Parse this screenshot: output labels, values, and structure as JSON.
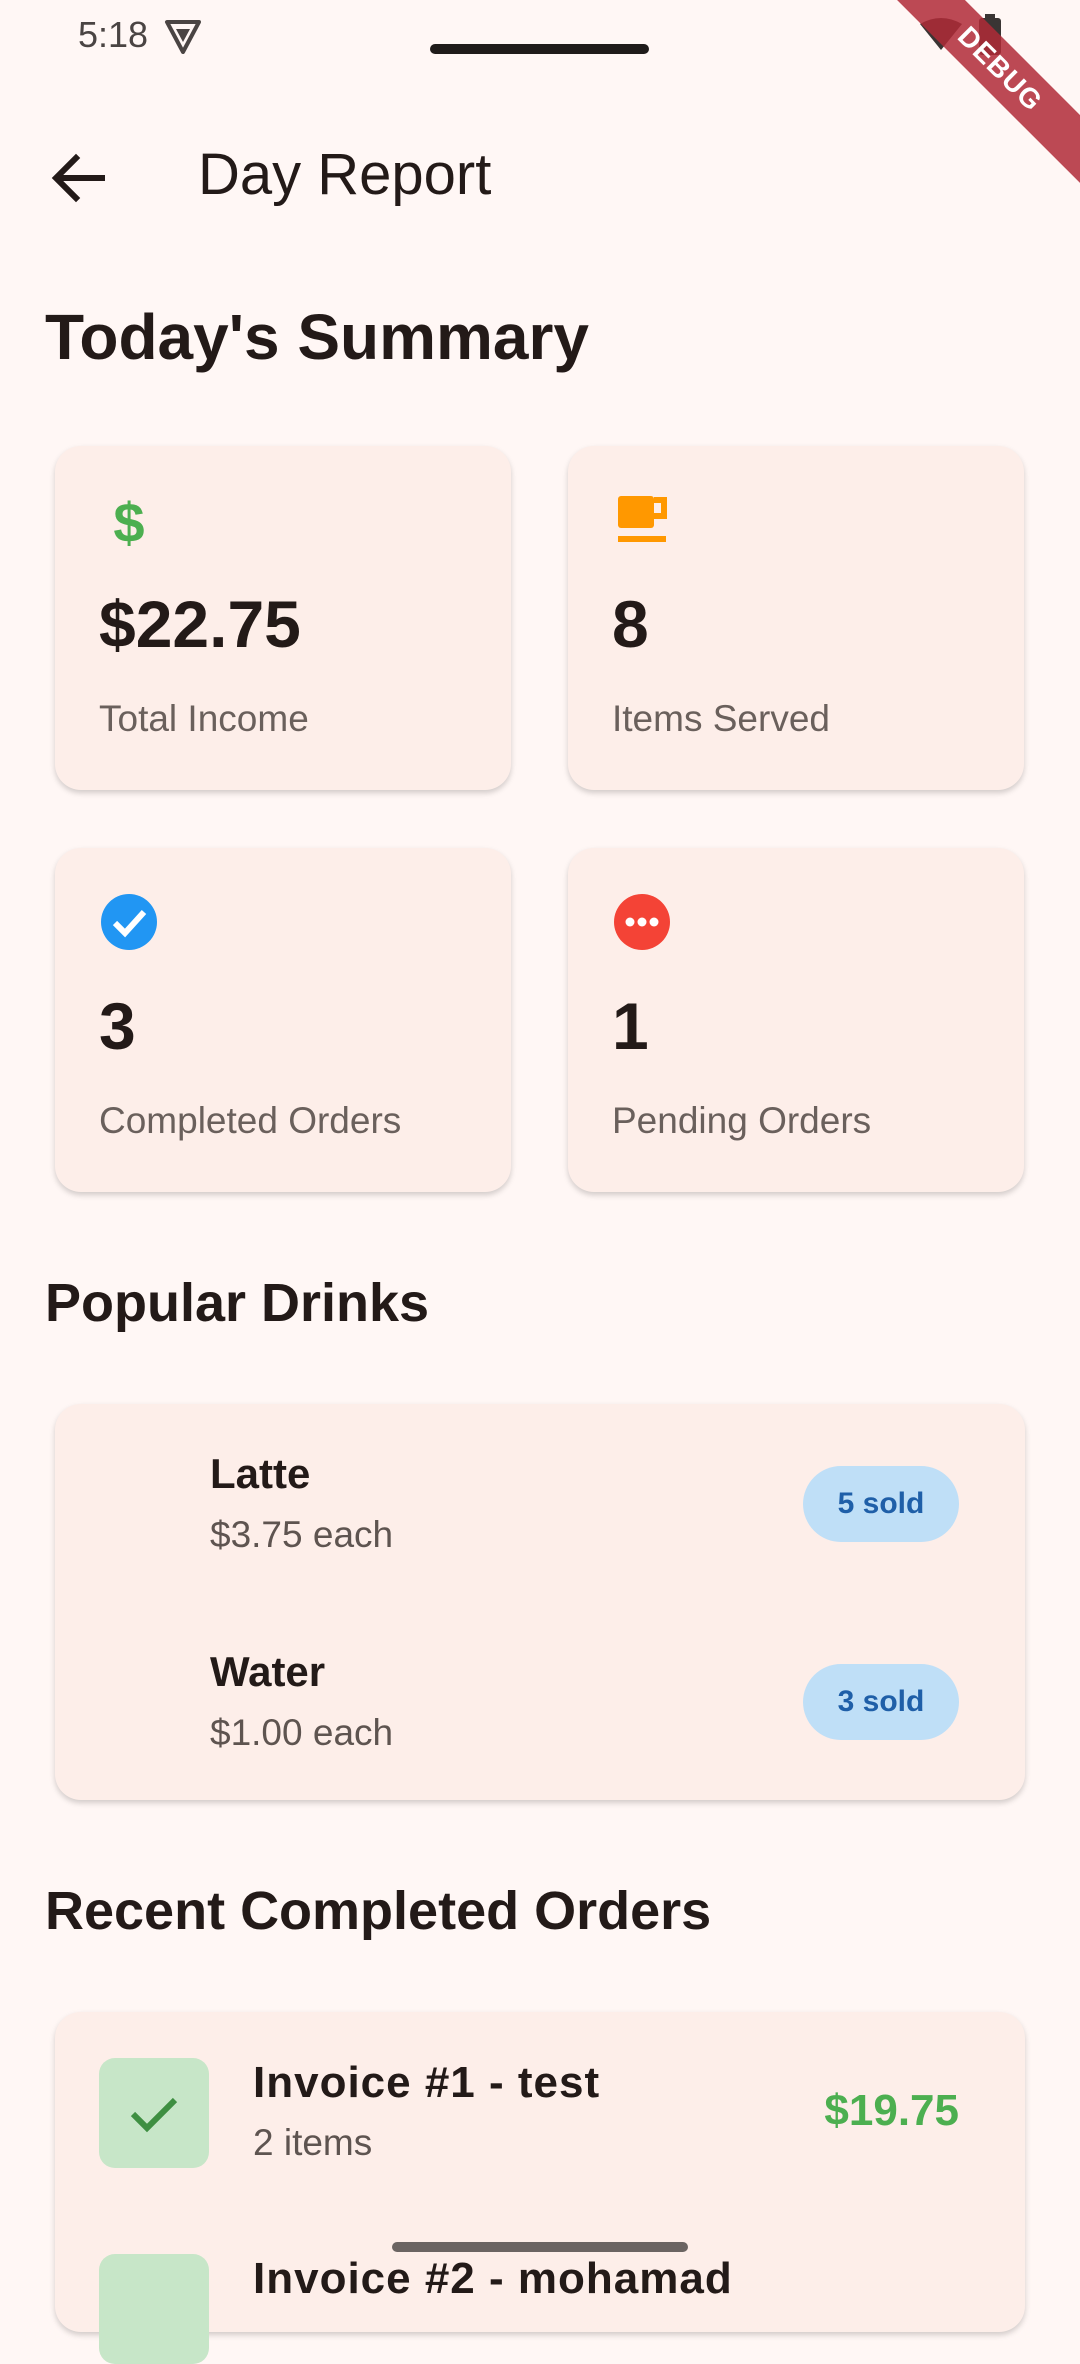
{
  "status_bar": {
    "time": "5:18",
    "debug_label": "DEBUG"
  },
  "app_bar": {
    "title": "Day Report"
  },
  "summary": {
    "title": "Today's Summary",
    "cards": [
      {
        "icon": "dollar-icon",
        "value": "$22.75",
        "label": "Total Income",
        "color": "#4caf50"
      },
      {
        "icon": "coffee-cup-icon",
        "value": "8",
        "label": "Items Served",
        "color": "#ff9800"
      },
      {
        "icon": "check-circle-icon",
        "value": "3",
        "label": "Completed Orders",
        "color": "#2196f3"
      },
      {
        "icon": "pending-icon",
        "value": "1",
        "label": "Pending Orders",
        "color": "#f44336"
      }
    ]
  },
  "popular": {
    "title": "Popular Drinks",
    "items": [
      {
        "name": "Latte",
        "price": "$3.75 each",
        "sold": "5 sold"
      },
      {
        "name": "Water",
        "price": "$1.00 each",
        "sold": "3 sold"
      }
    ]
  },
  "recent": {
    "title": "Recent Completed Orders",
    "orders": [
      {
        "title": "Invoice #1 - test",
        "items": "2 items",
        "amount": "$19.75"
      },
      {
        "title": "Invoice #2 - mohamad",
        "items": "",
        "amount": ""
      }
    ]
  }
}
